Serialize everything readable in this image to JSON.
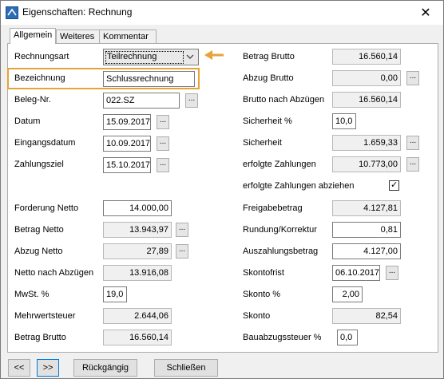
{
  "window": {
    "title": "Eigenschaften: Rechnung",
    "close_glyph": "✕"
  },
  "tabs": [
    "Allgemein",
    "Weiteres",
    "Kommentar"
  ],
  "left": {
    "rechnungsart": {
      "label": "Rechnungsart",
      "value": "Teilrechnung"
    },
    "bezeichnung": {
      "label": "Bezeichnung",
      "value": "Schlussrechnung"
    },
    "belegnr": {
      "label": "Beleg-Nr.",
      "value": "022.SZ"
    },
    "datum": {
      "label": "Datum",
      "value": "15.09.2017"
    },
    "eingangsdatum": {
      "label": "Eingangsdatum",
      "value": "10.09.2017"
    },
    "zahlungsziel": {
      "label": "Zahlungsziel",
      "value": "15.10.2017"
    },
    "forderung_netto": {
      "label": "Forderung Netto",
      "value": "14.000,00"
    },
    "betrag_netto": {
      "label": "Betrag Netto",
      "value": "13.943,97"
    },
    "abzug_netto": {
      "label": "Abzug Netto",
      "value": "27,89"
    },
    "netto_nach_abzuegen": {
      "label": "Netto nach Abzügen",
      "value": "13.916,08"
    },
    "mwst": {
      "label": "MwSt. %",
      "value": "19,0"
    },
    "mehrwertsteuer": {
      "label": "Mehrwertsteuer",
      "value": "2.644,06"
    },
    "betrag_brutto": {
      "label": "Betrag Brutto",
      "value": "16.560,14"
    }
  },
  "right": {
    "betrag_brutto": {
      "label": "Betrag Brutto",
      "value": "16.560,14"
    },
    "abzug_brutto": {
      "label": "Abzug Brutto",
      "value": "0,00"
    },
    "brutto_nach_abzuegen": {
      "label": "Brutto nach Abzügen",
      "value": "16.560,14"
    },
    "sicherheit_pct": {
      "label": "Sicherheit %",
      "value": "10,0"
    },
    "sicherheit": {
      "label": "Sicherheit",
      "value": "1.659,33"
    },
    "erfolgte_zahlungen": {
      "label": "erfolgte Zahlungen",
      "value": "10.773,00"
    },
    "erfolgte_abziehen": {
      "label": "erfolgte Zahlungen abziehen",
      "checked": true,
      "check_glyph": "✓"
    },
    "freigabebetrag": {
      "label": "Freigabebetrag",
      "value": "4.127,81"
    },
    "rundung": {
      "label": "Rundung/Korrektur",
      "value": "0,81"
    },
    "auszahlungsbetrag": {
      "label": "Auszahlungsbetrag",
      "value": "4.127,00"
    },
    "skontofrist": {
      "label": "Skontofrist",
      "value": "06.10.2017"
    },
    "skonto_pct": {
      "label": "Skonto %",
      "value": "2,00"
    },
    "skonto": {
      "label": "Skonto",
      "value": "82,54"
    },
    "bauabzugssteuer": {
      "label": "Bauabzugssteuer %",
      "value": "0,0"
    }
  },
  "ellipsis": "...",
  "footer": {
    "prev": "<<",
    "next": ">>",
    "undo": "Rückgängig",
    "close": "Schließen"
  },
  "colors": {
    "highlight": "#e8a23a",
    "arrow": "#e8a23a",
    "focus": "#0078d7"
  }
}
